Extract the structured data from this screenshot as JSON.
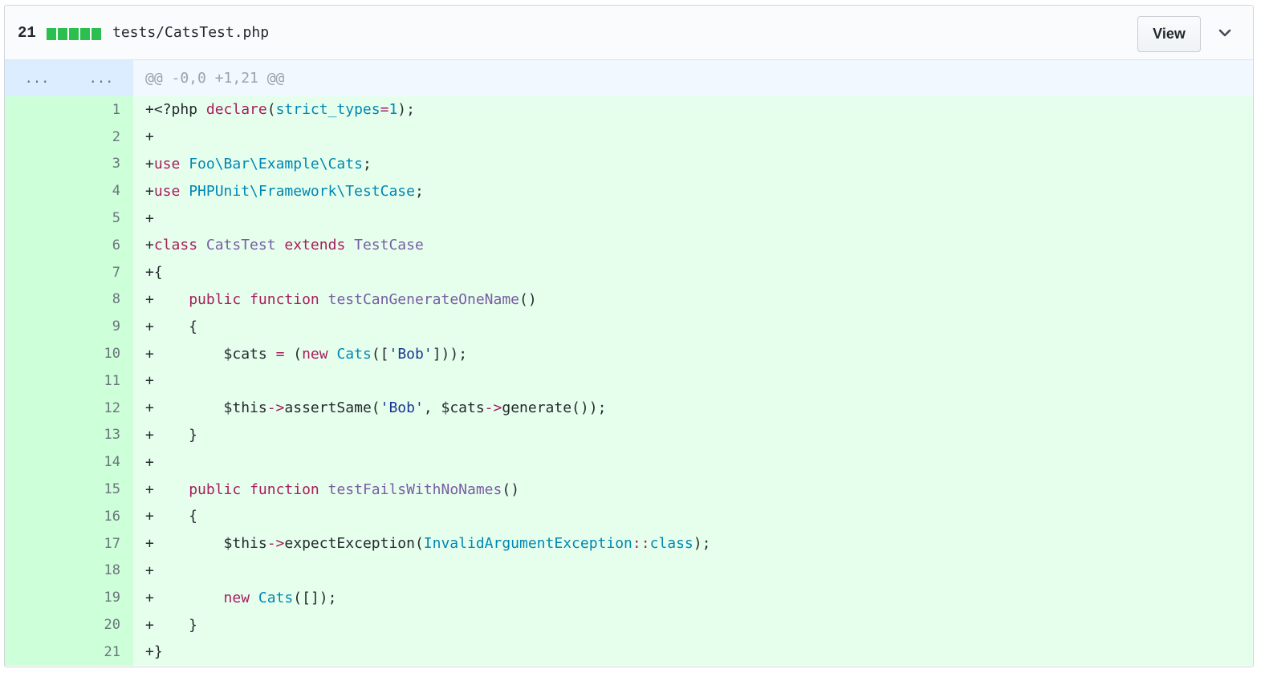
{
  "header": {
    "diffstat_count": "21",
    "diffstat_blocks": 5,
    "file_path": "tests/CatsTest.php",
    "view_label": "View"
  },
  "hunk": {
    "old_ln": "...",
    "new_ln": "...",
    "header": "@@ -0,0 +1,21 @@"
  },
  "colors": {
    "added_bg": "#e6ffed",
    "added_gutter": "#cdffd8",
    "hunk_bg": "#f1f8ff",
    "diffstat_green": "#2cbe4e",
    "keyword": "#a71d5d",
    "constant": "#0086b3",
    "type": "#795da3",
    "string": "#183691"
  },
  "lines": [
    {
      "n": "1",
      "tokens": [
        [
          "+<?php ",
          ""
        ],
        [
          "declare",
          "k"
        ],
        [
          "(",
          ""
        ],
        [
          "strict_types",
          "c"
        ],
        [
          "=",
          "k"
        ],
        [
          "1",
          "c"
        ],
        [
          ");",
          ""
        ]
      ]
    },
    {
      "n": "2",
      "tokens": [
        [
          "+",
          ""
        ]
      ]
    },
    {
      "n": "3",
      "tokens": [
        [
          "+",
          ""
        ],
        [
          "use",
          "k"
        ],
        [
          " ",
          ""
        ],
        [
          "Foo\\Bar\\Example\\Cats",
          "c"
        ],
        [
          ";",
          ""
        ]
      ]
    },
    {
      "n": "4",
      "tokens": [
        [
          "+",
          ""
        ],
        [
          "use",
          "k"
        ],
        [
          " ",
          ""
        ],
        [
          "PHPUnit\\Framework\\TestCase",
          "c"
        ],
        [
          ";",
          ""
        ]
      ]
    },
    {
      "n": "5",
      "tokens": [
        [
          "+",
          ""
        ]
      ]
    },
    {
      "n": "6",
      "tokens": [
        [
          "+",
          ""
        ],
        [
          "class",
          "k"
        ],
        [
          " ",
          ""
        ],
        [
          "CatsTest",
          "t"
        ],
        [
          " ",
          ""
        ],
        [
          "extends",
          "k"
        ],
        [
          " ",
          ""
        ],
        [
          "TestCase",
          "t"
        ]
      ]
    },
    {
      "n": "7",
      "tokens": [
        [
          "+{",
          ""
        ]
      ]
    },
    {
      "n": "8",
      "tokens": [
        [
          "+    ",
          ""
        ],
        [
          "public",
          "k"
        ],
        [
          " ",
          ""
        ],
        [
          "function",
          "k"
        ],
        [
          " ",
          ""
        ],
        [
          "testCanGenerateOneName",
          "t"
        ],
        [
          "()",
          ""
        ]
      ]
    },
    {
      "n": "9",
      "tokens": [
        [
          "+    {",
          ""
        ]
      ]
    },
    {
      "n": "10",
      "tokens": [
        [
          "+        $cats ",
          ""
        ],
        [
          "=",
          "k"
        ],
        [
          " (",
          ""
        ],
        [
          "new",
          "k"
        ],
        [
          " ",
          ""
        ],
        [
          "Cats",
          "c"
        ],
        [
          "([",
          ""
        ],
        [
          "'Bob'",
          "s"
        ],
        [
          "]));",
          ""
        ]
      ]
    },
    {
      "n": "11",
      "tokens": [
        [
          "+",
          ""
        ]
      ]
    },
    {
      "n": "12",
      "tokens": [
        [
          "+        $this",
          ""
        ],
        [
          "->",
          "k"
        ],
        [
          "assertSame(",
          ""
        ],
        [
          "'Bob'",
          "s"
        ],
        [
          ", $cats",
          ""
        ],
        [
          "->",
          "k"
        ],
        [
          "generate());",
          ""
        ]
      ]
    },
    {
      "n": "13",
      "tokens": [
        [
          "+    }",
          ""
        ]
      ]
    },
    {
      "n": "14",
      "tokens": [
        [
          "+",
          ""
        ]
      ]
    },
    {
      "n": "15",
      "tokens": [
        [
          "+    ",
          ""
        ],
        [
          "public",
          "k"
        ],
        [
          " ",
          ""
        ],
        [
          "function",
          "k"
        ],
        [
          " ",
          ""
        ],
        [
          "testFailsWithNoNames",
          "t"
        ],
        [
          "()",
          ""
        ]
      ]
    },
    {
      "n": "16",
      "tokens": [
        [
          "+    {",
          ""
        ]
      ]
    },
    {
      "n": "17",
      "tokens": [
        [
          "+        $this",
          ""
        ],
        [
          "->",
          "k"
        ],
        [
          "expectException(",
          ""
        ],
        [
          "InvalidArgumentException",
          "c"
        ],
        [
          "::",
          "k"
        ],
        [
          "class",
          "c"
        ],
        [
          ");",
          ""
        ]
      ]
    },
    {
      "n": "18",
      "tokens": [
        [
          "+",
          ""
        ]
      ]
    },
    {
      "n": "19",
      "tokens": [
        [
          "+        ",
          ""
        ],
        [
          "new",
          "k"
        ],
        [
          " ",
          ""
        ],
        [
          "Cats",
          "c"
        ],
        [
          "([]);",
          ""
        ]
      ]
    },
    {
      "n": "20",
      "tokens": [
        [
          "+    }",
          ""
        ]
      ]
    },
    {
      "n": "21",
      "tokens": [
        [
          "+}",
          ""
        ]
      ]
    }
  ]
}
